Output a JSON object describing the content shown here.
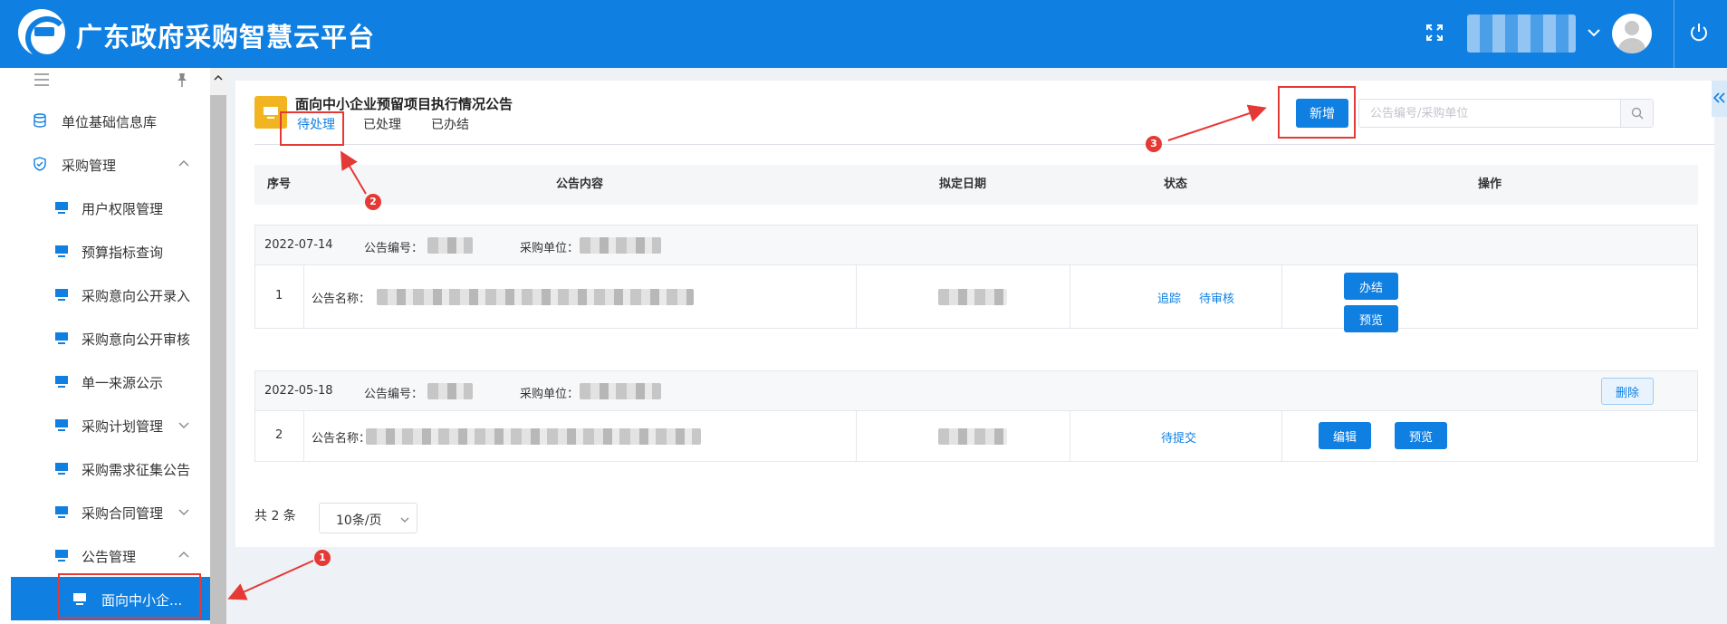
{
  "header": {
    "title": "广东政府采购智慧云平台",
    "icons": [
      "logo",
      "fullscreen-icon",
      "chevron-down-icon",
      "avatar",
      "power-icon"
    ]
  },
  "sidebar": {
    "items": [
      {
        "label": "单位基础信息库",
        "icon": "database-icon"
      },
      {
        "label": "采购管理",
        "icon": "shield-icon",
        "expanded": true
      },
      {
        "label": "用户权限管理",
        "icon": "monitor-icon"
      },
      {
        "label": "预算指标查询",
        "icon": "monitor-icon"
      },
      {
        "label": "采购意向公开录入",
        "icon": "monitor-icon"
      },
      {
        "label": "采购意向公开审核",
        "icon": "monitor-icon"
      },
      {
        "label": "单一来源公示",
        "icon": "monitor-icon"
      },
      {
        "label": "采购计划管理",
        "icon": "monitor-icon",
        "collapsed": true
      },
      {
        "label": "采购需求征集公告",
        "icon": "monitor-icon"
      },
      {
        "label": "采购合同管理",
        "icon": "monitor-icon",
        "collapsed": true
      },
      {
        "label": "公告管理",
        "icon": "monitor-icon",
        "expanded": true
      },
      {
        "label": "面向中小企...",
        "icon": "monitor-icon",
        "active": true
      }
    ]
  },
  "panel": {
    "title": "面向中小企业预留项目执行情况公告",
    "tabs": [
      {
        "label": "待处理",
        "active": true
      },
      {
        "label": "已处理"
      },
      {
        "label": "已办结"
      }
    ],
    "add_label": "新增",
    "search_placeholder": "公告编号/采购单位"
  },
  "table": {
    "headers": [
      "序号",
      "公告内容",
      "拟定日期",
      "状态",
      "操作"
    ],
    "groups": [
      {
        "date": "2022-07-14",
        "notice_no_label": "公告编号：",
        "unit_label": "采购单位：",
        "index": "1",
        "name_label": "公告名称：",
        "status": [
          "追踪",
          "待审核"
        ],
        "actions": [
          "办结",
          "预览"
        ]
      },
      {
        "date": "2022-05-18",
        "notice_no_label": "公告编号：",
        "unit_label": "采购单位：",
        "index": "2",
        "name_label": "公告名称：",
        "status": [
          "待提交"
        ],
        "head_action": "删除",
        "actions": [
          "编辑",
          "预览"
        ]
      }
    ]
  },
  "pager": {
    "total": "共 2 条",
    "page_size": "10条/页"
  },
  "annotations": [
    "1",
    "2",
    "3"
  ],
  "colors": {
    "brand": "#0f7fe2",
    "accent_icon": "#f1b521",
    "annotation": "#e53935"
  }
}
